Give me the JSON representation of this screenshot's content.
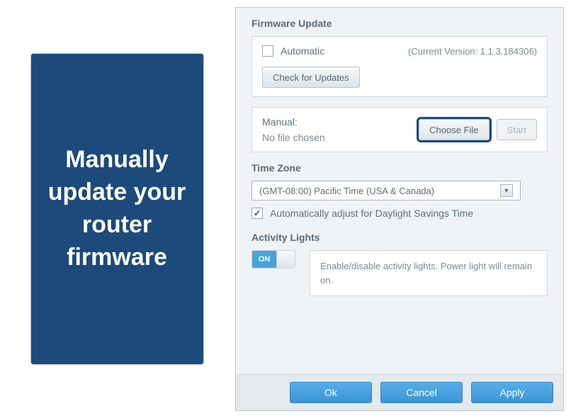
{
  "promo": {
    "text": "Manually update your router firmware"
  },
  "firmware": {
    "heading": "Firmware Update",
    "automatic_label": "Automatic",
    "automatic_checked": false,
    "current_version": "(Current Version: 1.1.3.184306)",
    "check_updates_label": "Check for Updates",
    "manual_label": "Manual:",
    "no_file_chosen": "No file chosen",
    "choose_file_label": "Choose File",
    "start_label": "Start"
  },
  "timezone": {
    "heading": "Time Zone",
    "selected": "(GMT-08:00) Pacific Time (USA & Canada)",
    "dst_checked": true,
    "dst_label": "Automatically adjust for Daylight Savings Time"
  },
  "activity": {
    "heading": "Activity Lights",
    "toggle_on_text": "ON",
    "toggle_state": true,
    "hint": "Enable/disable activity lights. Power light will remain on."
  },
  "footer": {
    "ok": "Ok",
    "cancel": "Cancel",
    "apply": "Apply"
  }
}
